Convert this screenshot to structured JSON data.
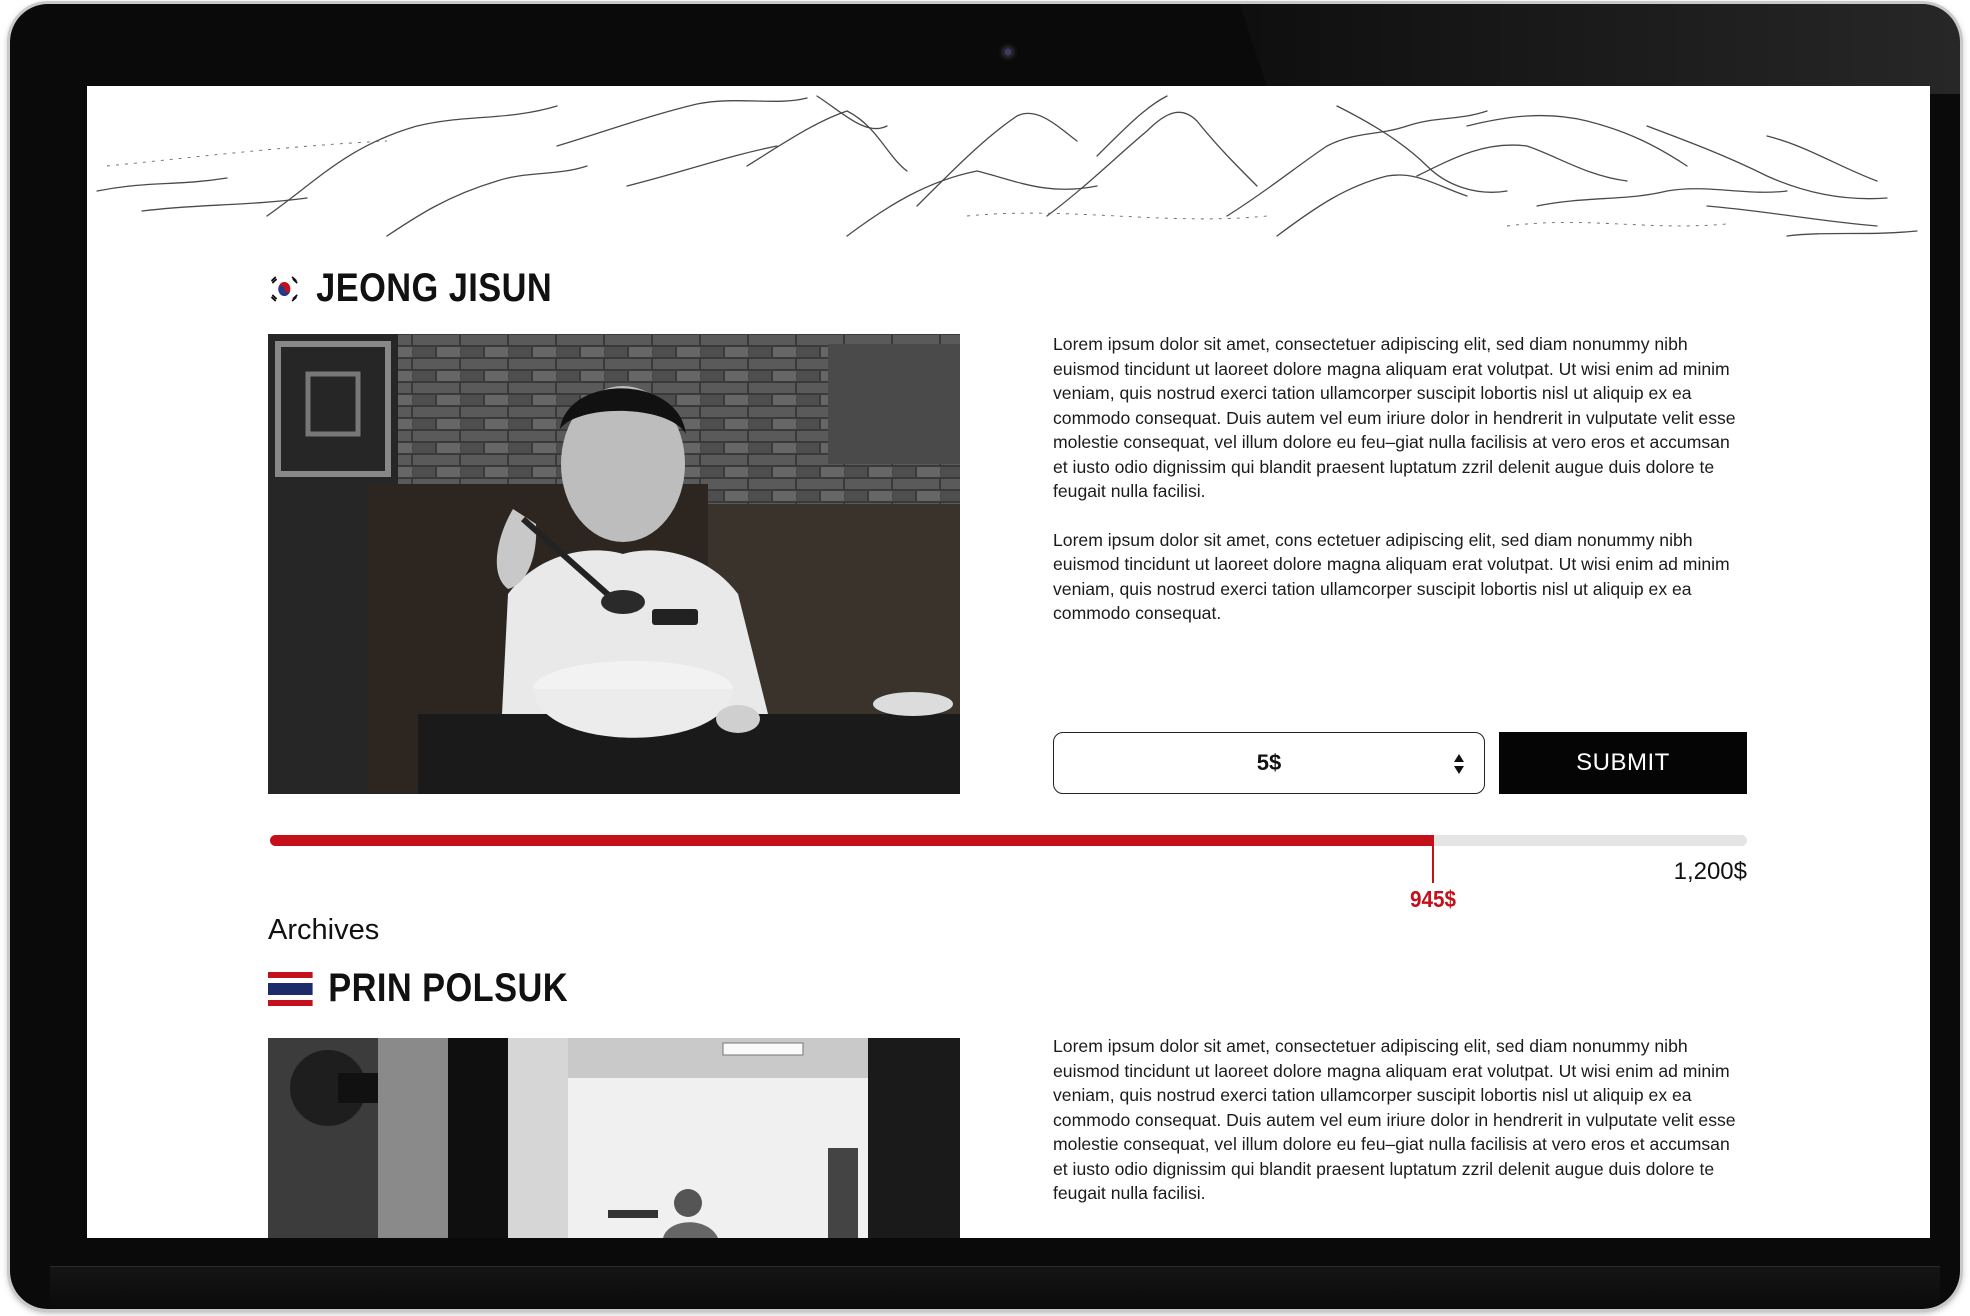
{
  "colors": {
    "accent": "#c4101b",
    "button_bg": "#050505",
    "track": "#e4e4e4"
  },
  "current_entry": {
    "flag_icon": "south-korea-flag-icon",
    "name": "JEONG JISUN",
    "photo_description_icon": "chef-photo",
    "bio_paragraphs": [
      "Lorem ipsum dolor sit amet, consectetuer adipiscing elit, sed diam nonummy nibh euismod tincidunt ut laoreet dolore magna aliquam erat volutpat. Ut wisi enim ad minim veniam, quis nostrud exerci tation ullamcorper suscipit lobortis nisl ut aliquip ex ea commodo consequat. Duis autem vel eum iriure dolor in hendrerit in vulputate velit esse molestie consequat, vel illum dolore eu feu–giat nulla facilisis at vero eros et accumsan et iusto odio dignissim qui blandit praesent luptatum zzril delenit augue duis dolore te feugait nulla facilisi.",
      "Lorem ipsum dolor sit amet, cons ectetuer adipiscing elit, sed diam nonummy nibh euismod tincidunt ut laoreet dolore magna aliquam erat volutpat. Ut wisi enim ad minim veniam, quis nostrud exerci tation ullamcorper suscipit lobortis nisl ut aliquip ex ea commodo consequat."
    ],
    "donation": {
      "selected_amount": "5$",
      "submit_label": "SUBMIT",
      "raised_label": "945$",
      "goal_label": "1,200$",
      "raised_value": 945,
      "goal_value": 1200
    }
  },
  "archives": {
    "heading": "Archives",
    "entries": [
      {
        "flag_icon": "thailand-flag-icon",
        "name": "PRIN POLSUK",
        "bio_paragraphs": [
          "Lorem ipsum dolor sit amet, consectetuer adipiscing elit, sed diam nonummy nibh euismod tincidunt ut laoreet dolore magna aliquam erat volutpat. Ut wisi enim ad minim veniam, quis nostrud exerci tation ullamcorper suscipit lobortis nisl ut aliquip ex ea commodo consequat. Duis autem vel eum iriure dolor in hendrerit in vulputate velit esse molestie consequat, vel illum dolore eu feu–giat nulla facilisis at vero eros et accumsan et iusto odio dignissim qui blandit praesent luptatum zzril delenit augue duis dolore te feugait nulla facilisi."
        ]
      }
    ]
  }
}
